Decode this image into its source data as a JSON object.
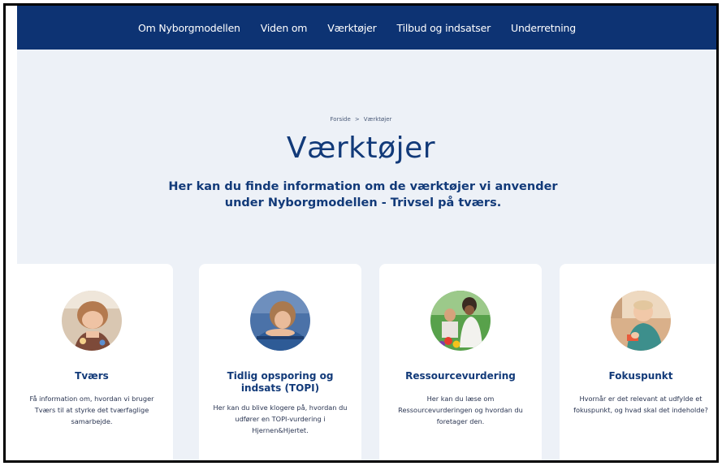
{
  "nav": {
    "items": [
      "Om Nyborgmodellen",
      "Viden om",
      "Værktøjer",
      "Tilbud og indsatser",
      "Underretning"
    ]
  },
  "breadcrumb": {
    "home": "Forside",
    "separator": ">",
    "current": "Værktøjer"
  },
  "hero": {
    "title": "Værktøjer",
    "intro": "Her kan du finde information om de værktøjer vi anvender under Nyborgmodellen - Trivsel på tværs."
  },
  "cards": [
    {
      "title": "Tværs",
      "description": "Få information om, hvordan vi bruger Tværs til at styrke det tværfaglige samarbejde.",
      "image": "child-playing-photo"
    },
    {
      "title": "Tidlig opsporing og indsats (TOPI)",
      "description": "Her kan du blive klogere på, hvordan du udfører en TOPI-vurdering i Hjernen&Hjertet.",
      "image": "girl-resting-photo"
    },
    {
      "title": "Ressourcevurdering",
      "description": "Her kan du læse om Ressourcevurderingen og hvordan du foretager den.",
      "image": "children-with-vegetables-photo"
    },
    {
      "title": "Fokuspunkt",
      "description": "Hvornår er det relevant at udfylde et fokuspunkt, og hvad skal det indeholde?",
      "image": "toddler-with-toy-photo"
    }
  ],
  "colors": {
    "nav_background": "#0d3373",
    "page_background": "#edf1f7",
    "heading": "#123a79"
  }
}
